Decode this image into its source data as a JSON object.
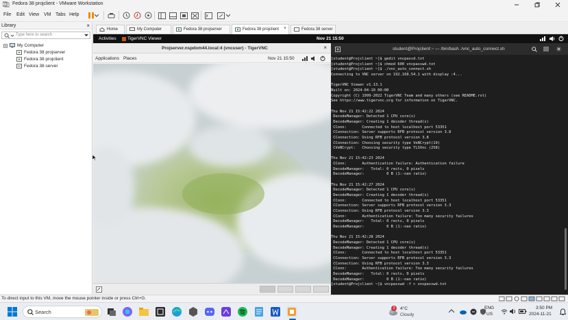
{
  "window": {
    "title": "Fedora 38 projclient - VMware Workstation"
  },
  "menu": [
    "File",
    "Edit",
    "View",
    "VM",
    "Tabs",
    "Help"
  ],
  "library": {
    "title": "Library",
    "search_placeholder": "Type here to search",
    "root": "My Computer",
    "items": [
      "Fedora 38 projserver",
      "Fedora 38 projclient",
      "Fedora 38 server"
    ]
  },
  "tabs": [
    {
      "label": "Home"
    },
    {
      "label": "My Computer"
    },
    {
      "label": "Fedora 38 projserver"
    },
    {
      "label": "Fedora 38 projclient"
    },
    {
      "label": "Fedora 38 server"
    }
  ],
  "guest": {
    "activities": "Activities",
    "app_name": "TigerVNC Viewer",
    "clock": "Nov 21  15:50"
  },
  "vnc": {
    "title": "Projserver.nspdom44.local:4 (vncuser) - TigerVNC",
    "applications": "Applications",
    "places": "Places",
    "remote_clock": "Nov 21  15:50"
  },
  "terminal": {
    "title": "student@Projclient:~ — /bin/bash ./vnc_auto_connect.sh",
    "lines": [
      "[student@Projclient ~]$ gedit vncpassd.txt",
      "[student@Projclient ~]$ chmod 600 vncpasswd.txt",
      "[student@Projclient ~]$ ./vnc_auto_connect.sh",
      "Connecting to VNC server on 192.168.54.1 with display :4...",
      "",
      "TigerVNC Viewer v1.13.1",
      "Built on: 2024-04-10 00:00",
      "Copyright (C) 1999-2022 TigerVNC Team and many others (see README.rst)",
      "See https://www.tigervnc.org for information on TigerVNC.",
      "",
      "Thu Nov 21 15:42:22 2024",
      " DecodeManager: Detected 1 CPU core(s)",
      " DecodeManager: Creating 1 decoder thread(s)",
      " CConn:       Connected to host localhost port 53351",
      " CConnection: Server supports RFB protocol version 3.8",
      " CConnection: Using RFB protocol version 3.8",
      " CConnection: Choosing security type VeNCrypt(19)",
      " CVeNCrypt:   Choosing security type TLSVnc (258)",
      "",
      "Thu Nov 21 15:42:23 2024",
      " CConn:       Authentication failure: Authentication failure",
      " DecodeManager:   Total: 0 rects, 0 pixels",
      " DecodeManager:          0 B (1:-nan ratio)",
      "",
      "Thu Nov 21 15:42:27 2024",
      " DecodeManager: Detected 1 CPU core(s)",
      " DecodeManager: Creating 1 decoder thread(s)",
      " CConn:       Connected to host localhost port 53351",
      " CConnection: Server supports RFB protocol version 3.3",
      " CConnection: Using RFB protocol version 3.3",
      " CConn:       Authentication failure: Too many security failures",
      " DecodeManager:   Total: 0 rects, 0 pixels",
      " DecodeManager:          0 B (1:-nan ratio)",
      "",
      "Thu Nov 21 15:42:28 2024",
      " DecodeManager: Detected 1 CPU core(s)",
      " DecodeManager: Creating 1 decoder thread(s)",
      " CConn:       Connected to host localhost port 53351",
      " CConnection: Server supports RFB protocol version 3.3",
      " CConnection: Using RFB protocol version 3.3",
      " CConn:       Authentication failure: Too many security failures",
      " DecodeManager:   Total: 0 rects, 0 pixels",
      " DecodeManager:          0 B (1:-nan ratio)",
      "[student@Projclient ~]$ vncpasswd -f > vncpasswd.txt"
    ]
  },
  "statusbar": {
    "message": "To direct input to this VM, move the mouse pointer inside or press Ctrl+G."
  },
  "taskbar": {
    "search_label": "Search",
    "weather_temp": "4°C",
    "weather_desc": "Cloudy",
    "weather_badge": "3",
    "lang": "ENG",
    "region": "US",
    "time": "3:50 PM",
    "date": "2024-11-21"
  },
  "colors": {
    "terminal_bg": "#1e1e1e",
    "taskbar_bg": "#eaeef2",
    "accent": "#0067c0"
  }
}
